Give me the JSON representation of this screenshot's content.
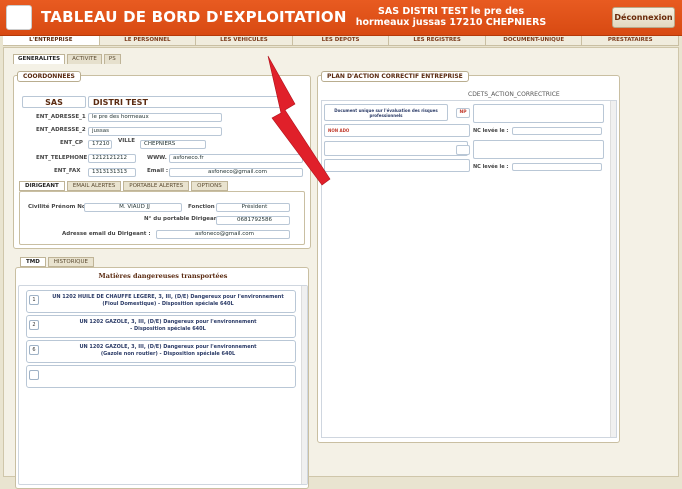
{
  "header": {
    "title": "TABLEAU DE BORD D'EXPLOITATION",
    "company_line1": "SAS  DISTRI TEST  le pre des",
    "company_line2": "hormeaux  jussas  17210  CHEPNIERS",
    "logout_label": "Déconnexion"
  },
  "topnav": {
    "tabs": [
      "L'ENTREPRISE",
      "LE PERSONNEL",
      "LES VEHICULES",
      "LES DEPOTS",
      "LES REGISTRES",
      "DOCUMENT-UNIQUE",
      "PRESTATAIRES"
    ],
    "active": "L'ENTREPRISE"
  },
  "subtabs": {
    "tabs": [
      "GENERALITES",
      "ACTIVITE",
      "PS"
    ]
  },
  "coordonnees": {
    "legend": "COORDONNEES",
    "legal_form": "SAS",
    "company_name": "DISTRI TEST",
    "labels": {
      "adresse1": "ENT_ADRESSE_1",
      "adresse2": "ENT_ADRESSE_2",
      "cp": "ENT_CP",
      "ville": "VILLE",
      "telephone": "ENT_TELEPHONE",
      "www": "WWW.",
      "fax": "ENT_FAX",
      "email": "Email :"
    },
    "values": {
      "adresse1": "le pre des hormeaux",
      "adresse2": "jussas",
      "cp": "17210",
      "ville": "CHEPNIERS",
      "telephone": "1212121212",
      "www": "asfoneco.fr",
      "fax": "1313131313",
      "email": "asfoneco@gmail.com"
    }
  },
  "dirigeant": {
    "tabs": [
      "DIRIGEANT",
      "EMAIL ALERTES",
      "PORTABLE ALERTES",
      "OPTIONS"
    ],
    "labels": {
      "civilite": "Civilité Prénom Nom :",
      "fonction": "Fonction :",
      "portable": "N° du portable Dirigeant :",
      "email": "Adresse email du Dirigeant :"
    },
    "values": {
      "civilite": "M. VIAUD JJ",
      "fonction": "Président",
      "portable": "0681792586",
      "email": "asfoneco@gmail.com"
    }
  },
  "tmd": {
    "tabs": [
      "TMD",
      "HISTORIQUE"
    ],
    "heading": "Matières dangereuses transportées",
    "items": [
      {
        "num": "1",
        "line1": "UN 1202 HUILE DE CHAUFFE LEGERE, 3, III, (D/E)  Dangereux pour l'environnement",
        "line2": "(Fioul Domestique) - Disposition spéciale 640L"
      },
      {
        "num": "2",
        "line1": "UN 1202 GAZOLE, 3, III, (D/E)  Dangereux pour l'environnement",
        "line2": "- Disposition spéciale 640L"
      },
      {
        "num": "6",
        "line1": "UN 1202 GAZOLE, 3, III, (D/E)  Dangereux pour l'environnement",
        "line2": "(Gazole non routier) - Disposition spéciale 640L"
      },
      {
        "num": "",
        "line1": "",
        "line2": ""
      }
    ]
  },
  "plan": {
    "legend": "PLAN D'ACTION CORRECTIF ENTREPRISE",
    "header": "CDETS_ACTION_CORRECTRICE",
    "doc_line1": "Document unique sur l'évaluation des risques",
    "doc_line2": "professionnels",
    "badge": "NP",
    "non_ado": "NON ADO",
    "nc_label1": "NC levée le :",
    "nc_label2": "NC levée le :"
  },
  "colors": {
    "header": "#e05518",
    "accent": "#5a2a10",
    "arrow": "#e0202a"
  }
}
